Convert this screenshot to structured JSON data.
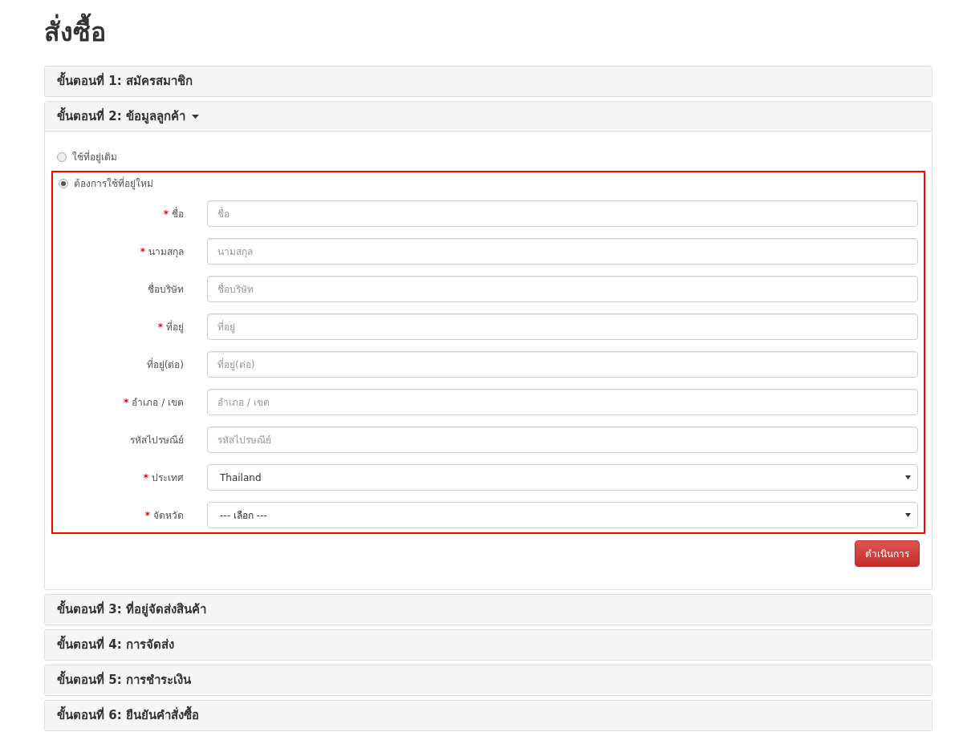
{
  "title": "สั่งซื้อ",
  "steps": [
    {
      "label": "ขั้นตอนที่ 1: สมัครสมาชิก",
      "expanded": false
    },
    {
      "label": "ขั้นตอนที่ 2: ข้อมูลลูกค้า",
      "expanded": true
    },
    {
      "label": "ขั้นตอนที่ 3: ที่อยู่จัดส่งสินค้า",
      "expanded": false
    },
    {
      "label": "ขั้นตอนที่ 4: การจัดส่ง",
      "expanded": false
    },
    {
      "label": "ขั้นตอนที่ 5: การชำระเงิน",
      "expanded": false
    },
    {
      "label": "ขั้นตอนที่ 6: ยืนยันคำสั่งซื้อ",
      "expanded": false
    }
  ],
  "address_options": [
    {
      "label": "ใช้ที่อยู่เดิม",
      "selected": false
    },
    {
      "label": "ต้องการใช้ที่อยู่ใหม่",
      "selected": true
    }
  ],
  "fields": [
    {
      "kind": "text",
      "label": "ชื่อ",
      "required": true,
      "placeholder": "ชื่อ"
    },
    {
      "kind": "text",
      "label": "นามสกุล",
      "required": true,
      "placeholder": "นามสกุล"
    },
    {
      "kind": "text",
      "label": "ชื่อบริษัท",
      "required": false,
      "placeholder": "ชื่อบริษัท"
    },
    {
      "kind": "text",
      "label": "ที่อยู่",
      "required": true,
      "placeholder": "ที่อยู่"
    },
    {
      "kind": "text",
      "label": "ที่อยู่(ต่อ)",
      "required": false,
      "placeholder": "ที่อยู่(ต่อ)"
    },
    {
      "kind": "text",
      "label": "อำเภอ / เขต",
      "required": true,
      "placeholder": "อำเภอ / เขต"
    },
    {
      "kind": "text",
      "label": "รหัสไปรษณีย์",
      "required": false,
      "placeholder": "รหัสไปรษณีย์"
    },
    {
      "kind": "select",
      "label": "ประเทศ",
      "required": true,
      "value": "Thailand"
    },
    {
      "kind": "select",
      "label": "จัดหวัด",
      "required": true,
      "value": "--- เลือก ---"
    }
  ],
  "required_mark": "*",
  "submit": "ดำเนินการ"
}
